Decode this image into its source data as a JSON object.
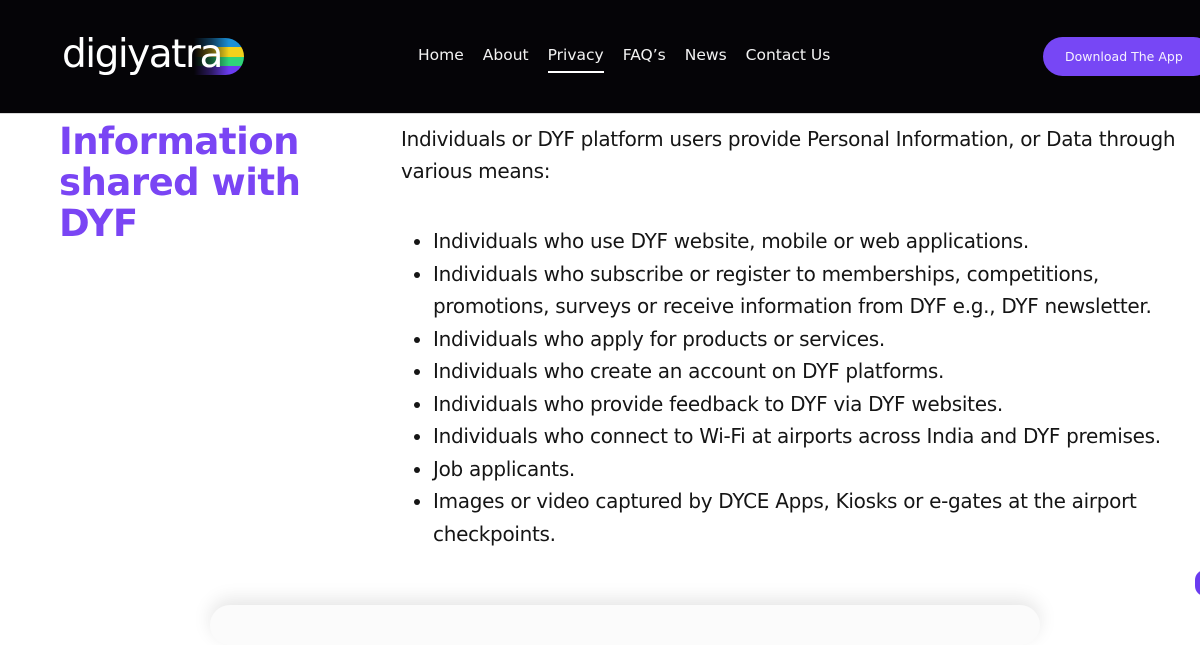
{
  "header": {
    "logo": {
      "text": "digiyatra",
      "mark_colors": [
        "#1a8fd6",
        "#f1d11c",
        "#2fd47a",
        "#6a3cf0"
      ]
    },
    "nav": [
      {
        "label": "Home",
        "active": false
      },
      {
        "label": "About",
        "active": false
      },
      {
        "label": "Privacy",
        "active": true
      },
      {
        "label": "FAQ’s",
        "active": false
      },
      {
        "label": "News",
        "active": false
      },
      {
        "label": "Contact Us",
        "active": false
      }
    ],
    "download_button": "Download The App"
  },
  "section": {
    "title": "Information shared with DYF",
    "intro": "Individuals or DYF platform users provide Personal Information, or Data through various means:",
    "items": [
      "Individuals who use DYF website, mobile or web applications.",
      "Individuals who subscribe or register to memberships, competitions, promotions, surveys or receive information from DYF e.g., DYF newsletter.",
      "Individuals who apply for products or services.",
      "Individuals who create an account on DYF platforms.",
      "Individuals who provide feedback to DYF via DYF websites.",
      "Individuals who connect to Wi-Fi at airports across India and DYF premises.",
      "Job applicants.",
      "Images or video captured by DYCE Apps, Kiosks or e-gates at the airport checkpoints."
    ]
  },
  "colors": {
    "header_bg": "#050407",
    "accent": "#7747f5",
    "title": "#7a45f4"
  }
}
